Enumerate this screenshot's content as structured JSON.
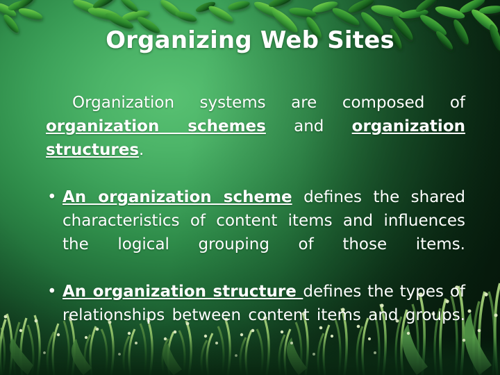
{
  "slide": {
    "title": "Organizing Web Sites",
    "theme": {
      "background_bright_green": "#4cb468",
      "background_dark_green": "#133f20",
      "leaf_green": "#4fbe4a",
      "leaf_dark_green": "#1f7a2a",
      "grass_green": "#8fbf6a",
      "text_color": "#ffffff"
    },
    "body": {
      "intro": {
        "segments": [
          {
            "text": "Organization  systems  are  composed  of  ",
            "style": "normal"
          },
          {
            "text": "organization  schemes",
            "style": "bold-underline"
          },
          {
            "text": "  and  ",
            "style": "normal"
          },
          {
            "text": "organization structures",
            "style": "bold-underline"
          },
          {
            "text": ".",
            "style": "normal"
          }
        ],
        "plain": "Organization systems are composed of organization schemes and organization structures."
      },
      "bullets": [
        {
          "marker": "•",
          "segments": [
            {
              "text": "An  organization  scheme",
              "style": "bold-underline"
            },
            {
              "text": " defines the shared characteristics of content items and influences the logical grouping of those items.",
              "style": "normal"
            }
          ],
          "plain": "An organization scheme defines the shared characteristics of content items and influences the logical grouping of those items."
        },
        {
          "marker": "•",
          "segments": [
            {
              "text": "An  organization  structure ",
              "style": "bold-underline"
            },
            {
              "text": "defines the types of relationships between content items and groups.",
              "style": "normal"
            }
          ],
          "plain": "An organization structure defines the types of relationships between content items and groups."
        }
      ]
    },
    "decoration": {
      "top_border": "green-leaves",
      "bottom_border": "grass-blades-with-seed-heads"
    }
  }
}
